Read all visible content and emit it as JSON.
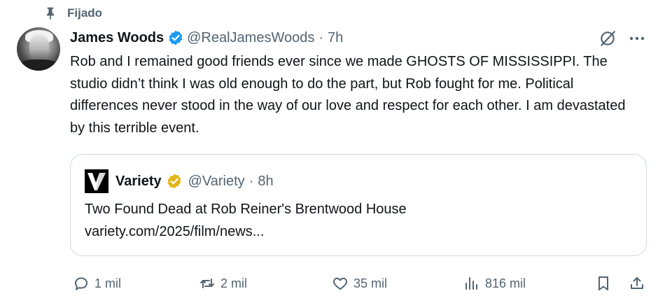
{
  "pinned": {
    "label": "Fijado"
  },
  "tweet": {
    "author_name": "James Woods",
    "handle": "@RealJamesWoods",
    "separator": "·",
    "time": "7h",
    "text": "Rob and I remained good friends ever since we made GHOSTS OF MISSISSIPPI. The studio didn’t think I was old enough to do the part, but Rob fought for me. Political differences never stood in the way of our love and respect for each other. I am devastated by this terrible event."
  },
  "quote": {
    "author_name": "Variety",
    "handle": "@Variety",
    "separator": "·",
    "time": "8h",
    "title": "Two Found Dead at Rob Reiner's Brentwood House",
    "link": "variety.com/2025/film/news..."
  },
  "actions": {
    "replies": "1 mil",
    "reposts": "2 mil",
    "likes": "35 mil",
    "views": "816 mil"
  },
  "colors": {
    "text_primary": "#0f1419",
    "text_secondary": "#536471",
    "verified_blue": "#1d9bf0",
    "verified_gold": "#e2b719",
    "border": "#cfd9de"
  },
  "icons": {
    "pin": "pin-icon",
    "verified": "verified-badge-icon",
    "gold_verified": "gold-verified-badge-icon",
    "grok": "grok-icon",
    "more": "more-icon",
    "reply": "reply-icon",
    "repost": "repost-icon",
    "like": "like-icon",
    "views": "views-icon",
    "bookmark": "bookmark-icon",
    "share": "share-icon"
  }
}
